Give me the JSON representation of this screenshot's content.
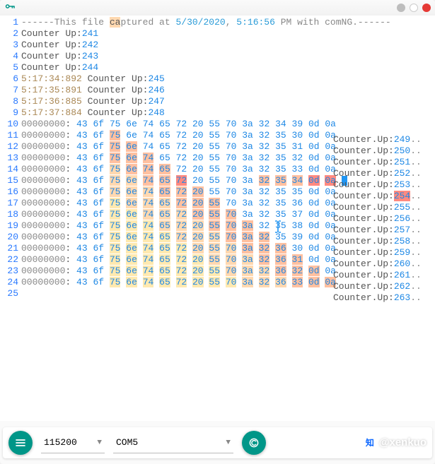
{
  "titlebar": {
    "icon": "key-icon"
  },
  "header_line": {
    "prefix": "------This file ",
    "word_ca": "ca",
    "word_ptur": "ptur",
    "word_ed_at": "ed at ",
    "date": "5/30/2020",
    "comma": ", ",
    "time": "5:16:56",
    "suffix": " PM with comNG.------"
  },
  "plain_lines": [
    {
      "ln": 2,
      "label": "Counter Up:",
      "val": "241"
    },
    {
      "ln": 3,
      "label": "Counter Up:",
      "val": "242"
    },
    {
      "ln": 4,
      "label": "Counter Up:",
      "val": "243"
    },
    {
      "ln": 5,
      "label": "Counter Up:",
      "val": "244"
    }
  ],
  "ts_lines": [
    {
      "ln": 6,
      "ts": "5:17:34:892",
      "label": " Counter Up:",
      "val": "245"
    },
    {
      "ln": 7,
      "ts": "5:17:35:891",
      "label": " Counter Up:",
      "val": "246"
    },
    {
      "ln": 8,
      "ts": "5:17:36:885",
      "label": " Counter Up:",
      "val": "247"
    },
    {
      "ln": 9,
      "ts": "5:17:37:884",
      "label": " Counter Up:",
      "val": "248"
    }
  ],
  "hex_lines": [
    {
      "ln": 10,
      "addr": "00000000",
      "hex": "43 6f 75 6e 74 65 72 20 55 70 3a 32 34 39 0d 0a",
      "ascii": "Counter.Up:",
      "val": "249",
      "trailing": ".."
    },
    {
      "ln": 11,
      "addr": "00000000",
      "hex": "43 6f 75 6e 74 65 72 20 55 70 3a 32 35 30 0d 0a",
      "ascii": "Counter.Up:",
      "val": "250",
      "trailing": ".."
    },
    {
      "ln": 12,
      "addr": "00000000",
      "hex": "43 6f 75 6e 74 65 72 20 55 70 3a 32 35 31 0d 0a",
      "ascii": "Counter.Up:",
      "val": "251",
      "trailing": ".."
    },
    {
      "ln": 13,
      "addr": "00000000",
      "hex": "43 6f 75 6e 74 65 72 20 55 70 3a 32 35 32 0d 0a",
      "ascii": "Counter.Up:",
      "val": "252",
      "trailing": ".."
    },
    {
      "ln": 14,
      "addr": "00000000",
      "hex": "43 6f 75 6e 74 65 72 20 55 70 3a 32 35 33 0d 0a",
      "ascii": "Counter.Up:",
      "val": "253",
      "trailing": ".."
    },
    {
      "ln": 15,
      "addr": "00000000",
      "hex": "43 6f 75 6e 74 65 72 20 55 70 3a 32 35 34 0d 0a",
      "ascii": "Counter.Up:",
      "val": "254",
      "trailing": "..",
      "caret": true
    },
    {
      "ln": 16,
      "addr": "00000000",
      "hex": "43 6f 75 6e 74 65 72 20 55 70 3a 32 35 35 0d 0a",
      "ascii": "Counter.Up:",
      "val": "255",
      "trailing": ".."
    },
    {
      "ln": 17,
      "addr": "00000000",
      "hex": "43 6f 75 6e 74 65 72 20 55 70 3a 32 35 36 0d 0a",
      "ascii": "Counter.Up:",
      "val": "256",
      "trailing": ".."
    },
    {
      "ln": 18,
      "addr": "00000000",
      "hex": "43 6f 75 6e 74 65 72 20 55 70 3a 32 35 37 0d 0a",
      "ascii": "Counter.Up:",
      "val": "257",
      "trailing": ".."
    },
    {
      "ln": 19,
      "addr": "00000000",
      "hex": "43 6f 75 6e 74 65 72 20 55 70 3a 32 35 38 0d 0a",
      "ascii": "Counter.Up:",
      "val": "258",
      "trailing": ".."
    },
    {
      "ln": 20,
      "addr": "00000000",
      "hex": "43 6f 75 6e 74 65 72 20 55 70 3a 32 35 39 0d 0a",
      "ascii": "Counter.Up:",
      "val": "259",
      "trailing": ".."
    },
    {
      "ln": 21,
      "addr": "00000000",
      "hex": "43 6f 75 6e 74 65 72 20 55 70 3a 32 36 30 0d 0a",
      "ascii": "Counter.Up:",
      "val": "260",
      "trailing": ".."
    },
    {
      "ln": 22,
      "addr": "00000000",
      "hex": "43 6f 75 6e 74 65 72 20 55 70 3a 32 36 31 0d 0a",
      "ascii": "Counter.Up:",
      "val": "261",
      "trailing": ".."
    },
    {
      "ln": 23,
      "addr": "00000000",
      "hex": "43 6f 75 6e 74 65 72 20 55 70 3a 32 36 32 0d 0a",
      "ascii": "Counter.Up:",
      "val": "262",
      "trailing": ".."
    },
    {
      "ln": 24,
      "addr": "00000000",
      "hex": "43 6f 75 6e 74 65 72 20 55 70 3a 32 36 33 0d 0a",
      "ascii": "Counter.Up:",
      "val": "263",
      "trailing": ".."
    }
  ],
  "last_gutter": "25",
  "cursor_line_index": 9,
  "bottombar": {
    "menu_icon": "menu-icon",
    "baud": "115200",
    "port": "COM5",
    "copy_icon": "copy-icon"
  },
  "watermark": {
    "logo": "知",
    "text": "@xenkuo"
  }
}
